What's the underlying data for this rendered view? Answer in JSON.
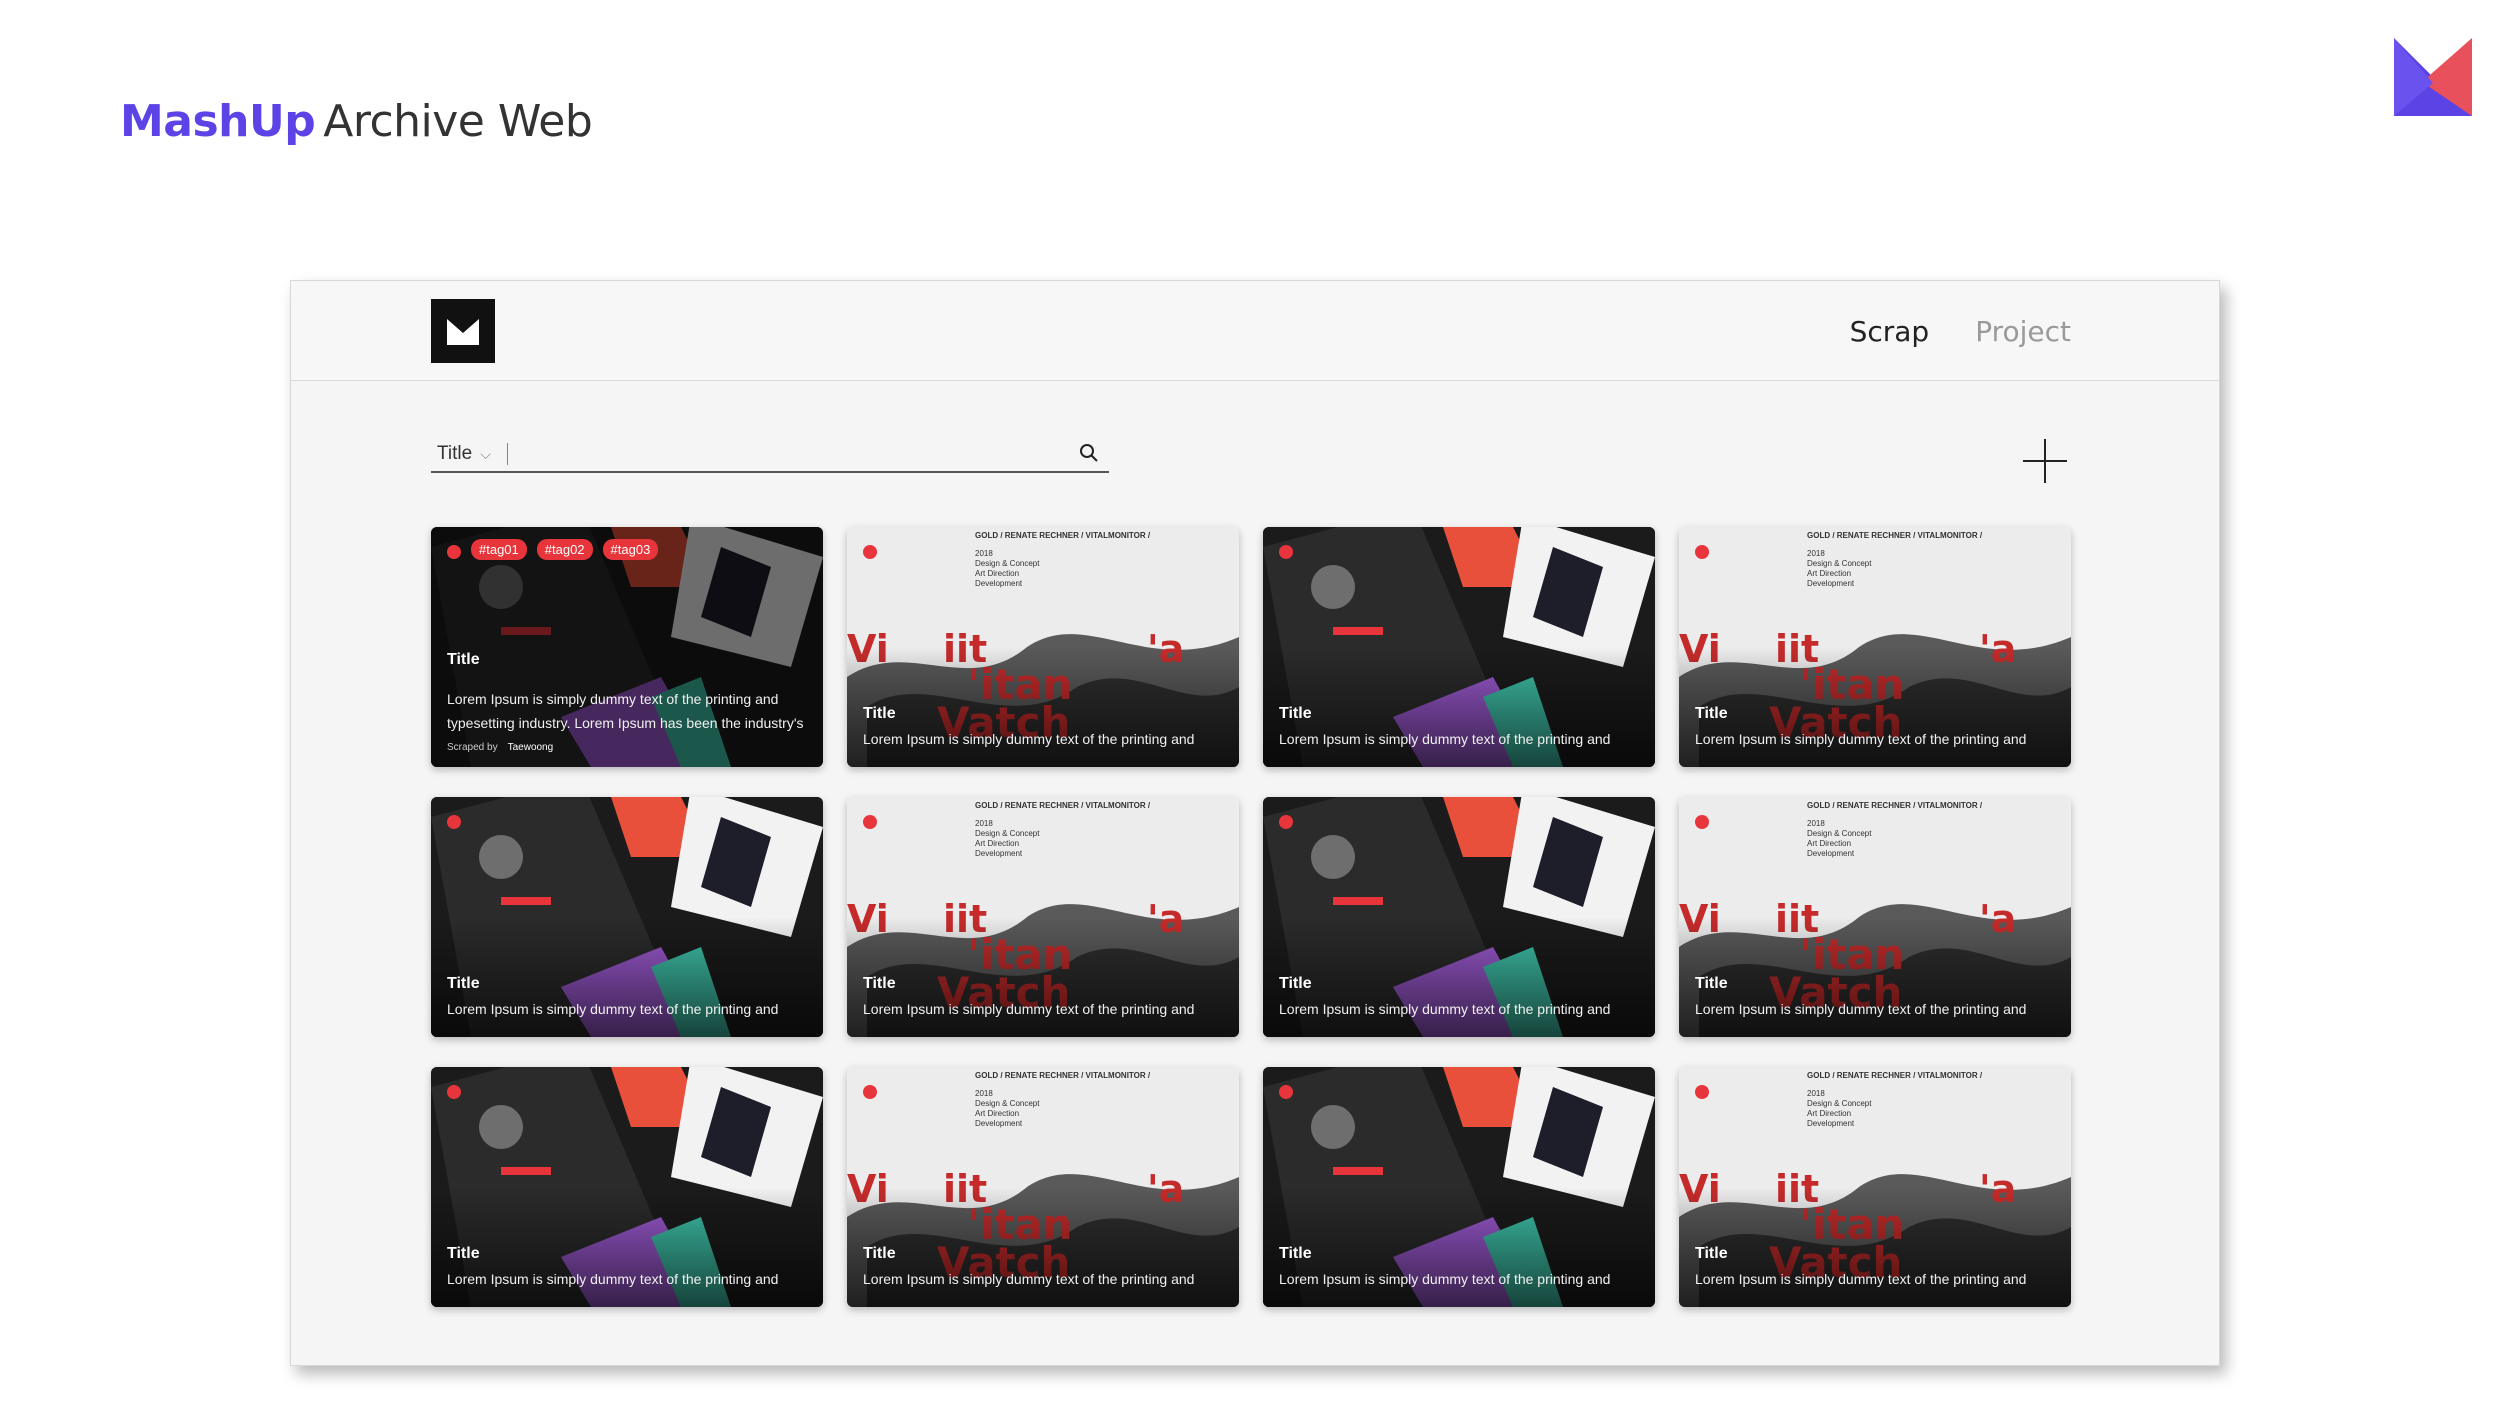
{
  "slide": {
    "brand": "MashUp",
    "title_rest": "Archive Web",
    "brand_color": "#5b43e6",
    "corner_logo_colors": [
      "#5b43e6",
      "#e8505b"
    ]
  },
  "topbar": {
    "logo_icon": "mashup-m-logo",
    "nav": [
      {
        "label": "Scrap",
        "active": true
      },
      {
        "label": "Project",
        "active": false
      }
    ]
  },
  "search": {
    "filter_selected": "Title",
    "placeholder": "",
    "icon": "search-icon"
  },
  "add_button_icon": "plus-icon",
  "card_project_meta": {
    "line1": "GOLD / RENATE RECHNER / VITALMONITOR /",
    "line2": "2018",
    "line3": "Design & Concept",
    "line4": "Art Direction",
    "line5": "Development"
  },
  "cards": [
    {
      "variant": "dark",
      "hover": true,
      "tags": [
        "#tag01",
        "#tag02",
        "#tag03"
      ],
      "title": "Title",
      "description": "Lorem Ipsum is simply dummy text of the printing and typesetting industry. Lorem Ipsum has been the industry's",
      "byline_label": "Scraped by",
      "author": "Taewoong"
    },
    {
      "variant": "light",
      "title": "Title",
      "description": "Lorem Ipsum is simply dummy text of the printing and"
    },
    {
      "variant": "dark",
      "title": "Title",
      "description": "Lorem Ipsum is simply dummy text of the printing and"
    },
    {
      "variant": "light",
      "title": "Title",
      "description": "Lorem Ipsum is simply dummy text of the printing and"
    },
    {
      "variant": "dark",
      "title": "Title",
      "description": "Lorem Ipsum is simply dummy text of the printing and"
    },
    {
      "variant": "light",
      "title": "Title",
      "description": "Lorem Ipsum is simply dummy text of the printing and"
    },
    {
      "variant": "dark",
      "title": "Title",
      "description": "Lorem Ipsum is simply dummy text of the printing and"
    },
    {
      "variant": "light",
      "title": "Title",
      "description": "Lorem Ipsum is simply dummy text of the printing and"
    },
    {
      "variant": "dark",
      "title": "Title",
      "description": "Lorem Ipsum is simply dummy text of the printing and"
    },
    {
      "variant": "light",
      "title": "Title",
      "description": "Lorem Ipsum is simply dummy text of the printing and"
    },
    {
      "variant": "dark",
      "title": "Title",
      "description": "Lorem Ipsum is simply dummy text of the printing and"
    },
    {
      "variant": "light",
      "title": "Title",
      "description": "Lorem Ipsum is simply dummy text of the printing and"
    }
  ]
}
